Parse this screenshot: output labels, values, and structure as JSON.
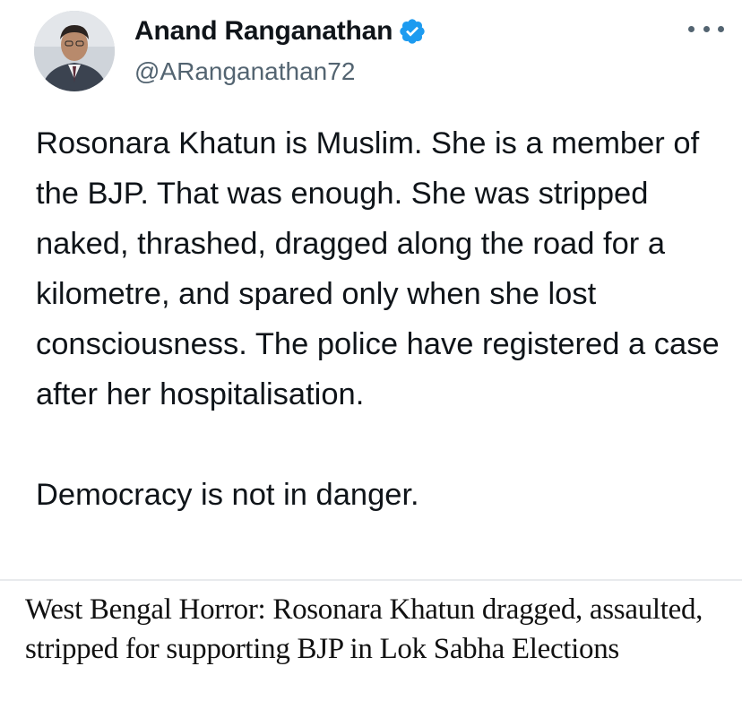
{
  "tweet": {
    "author_name": "Anand Ranganathan",
    "handle": "@ARanganathan72",
    "verified": true,
    "verified_badge_color": "#1d9bf0",
    "paragraph_1": "Rosonara Khatun is Muslim. She is a member of the BJP. That was enough. She was stripped naked, thrashed, dragged along the road for a kilometre, and spared only when she lost consciousness. The police have registered a case after her hospitalisation.",
    "paragraph_2": "Democracy is not in danger."
  },
  "icons": {
    "avatar": "avatar-photo",
    "verified": "verified-check-icon",
    "more": "more-options-icon"
  },
  "article": {
    "headline": "West Bengal Horror: Rosonara Khatun dragged, assaulted, stripped for supporting BJP in Lok Sabha Elections"
  }
}
